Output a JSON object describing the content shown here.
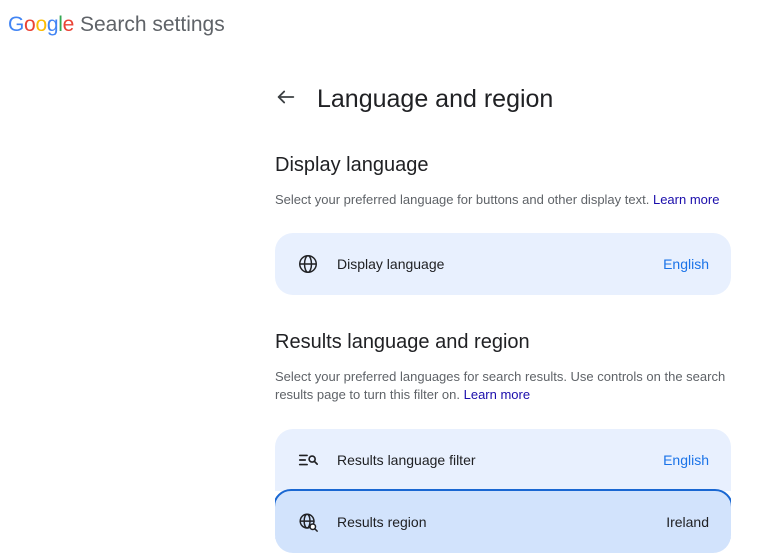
{
  "header": {
    "logo_letters": [
      "G",
      "o",
      "o",
      "g",
      "l",
      "e"
    ],
    "app_title": "Search settings"
  },
  "page": {
    "title": "Language and region"
  },
  "sections": [
    {
      "id": "display",
      "heading": "Display language",
      "desc": "Select your preferred language for buttons and other display text.",
      "learn": "Learn more",
      "cards": [
        {
          "id": "display-language",
          "label": "Display language",
          "value": "English",
          "value_style": "accent",
          "icon": "globe",
          "highlight": false
        }
      ]
    },
    {
      "id": "results",
      "heading": "Results language and region",
      "desc": "Select your preferred languages for search results. Use controls on the search results page to turn this filter on.",
      "learn": "Learn more",
      "cards": [
        {
          "id": "results-language-filter",
          "label": "Results language filter",
          "value": "English",
          "value_style": "accent",
          "icon": "eq-search",
          "highlight": false
        },
        {
          "id": "results-region",
          "label": "Results region",
          "value": "Ireland",
          "value_style": "neutral",
          "icon": "region-search",
          "highlight": true
        }
      ]
    }
  ]
}
